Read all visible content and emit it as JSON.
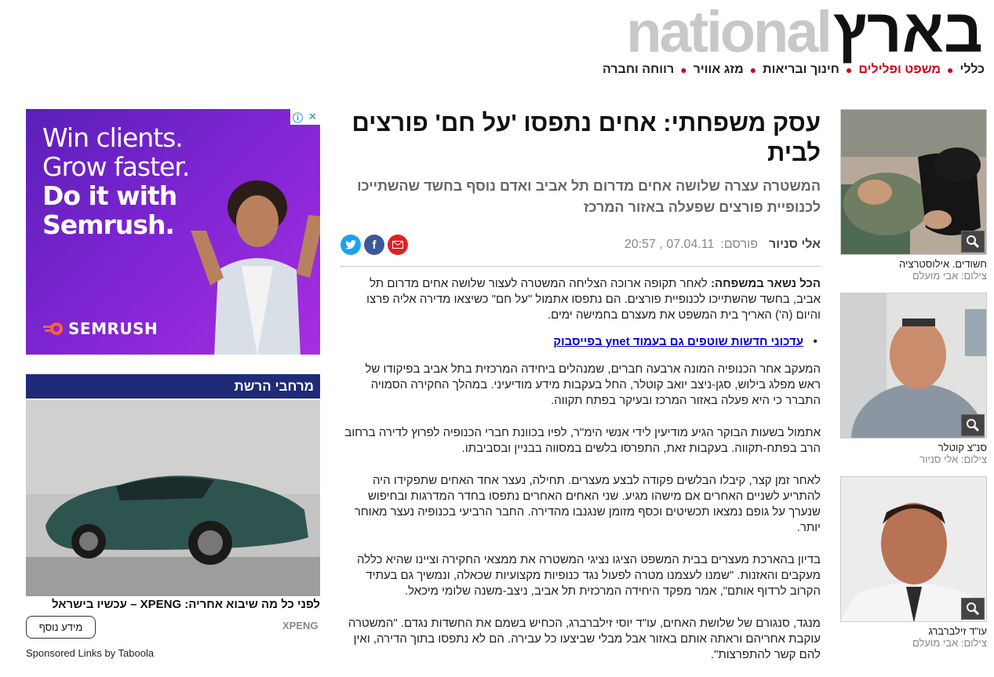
{
  "logo": {
    "national": "national",
    "hebrew": "בארץ"
  },
  "nav": {
    "items": [
      {
        "label": "כללי",
        "active": false
      },
      {
        "label": "משפט ופלילים",
        "active": true
      },
      {
        "label": "חינוך ובריאות",
        "active": false
      },
      {
        "label": "מזג אוויר",
        "active": false
      },
      {
        "label": "רווחה וחברה",
        "active": false
      }
    ]
  },
  "article": {
    "headline": "עסק משפחתי: אחים נתפסו 'על חם' פורצים לבית",
    "subtitle": "המשטרה עצרה שלושה אחים מדרום תל אביב ואדם נוסף בחשד שהשתייכו לכנופיית פורצים שפעלה באזור המרכז",
    "author": "אלי סניור",
    "published_label": "פורסם:",
    "date": "07.04.11",
    "time": "20:57",
    "lead_label": "הכל נשאר במשפחה:",
    "lead_text": " לאחר תקופה ארוכה הצליחה המשטרה לעצור שלושה אחים מדרום תל אביב, בחשד שהשתייכו לכנופיית פורצים. הם נתפסו אתמול \"על חם\" כשיצאו מדירה אליה פרצו והיום (ה') האריך בית המשפט את מעצרם בחמישה ימים.",
    "fb_link": "עדכוני חדשות שוטפים גם בעמוד ynet בפייסבוק",
    "paragraphs": [
      "המעקב אחר הכנופיה המונה ארבעה חברים, שמנהלים ביחידה המרכזית בתל אביב בפיקודו של ראש מפלג בילוש, סגן-ניצב יואב קוטלר, החל בעקבות מידע מודיעיני. במהלך החקירה הסמויה התברר כי היא פעלה באזור המרכז ובעיקר בפתח תקווה.",
      "אתמול בשעות הבוקר הגיע מודיעין לידי אנשי הימ\"ר, לפיו בכוונת חברי הכנופיה לפרוץ לדירה ברחוב הרב בפתח-תקווה. בעקבות זאת, התפרסו בלשים במסווה בבניין ובסביבתו.",
      "לאחר זמן קצר, קיבלו הבלשים פקודה לבצע מעצרים. תחילה, נעצר אחד האחים שתפקידו היה להתריע לשניים האחרים אם מישהו מגיע. שני האחים האחרים נתפסו בחדר המדרגות ובחיפוש שנערך על גופם נמצאו תכשיטים וכסף מזומן שנגנבו מהדירה. החבר הרביעי בכנופיה נעצר מאוחר יותר.",
      "בדיון בהארכת מעצרים בבית המשפט הציגו נציגי המשטרה את ממצאי החקירה וציינו שהיא כללה מעקבים והאזנות. \"שמנו לעצמנו מטרה לפעול נגד כנופיות מקצועיות שכאלה, ונמשיך גם בעתיד הקרוב לרדוף אותם\", אמר מפקד היחידה המרכזית תל אביב, ניצב-משנה שלומי מיכאל.",
      "מנגד, סנגורם של שלושת האחים, עו\"ד יוסי זילברברג, הכחיש בשמם את החשדות נגדם. \"המשטרה עוקבת אחריהם וראתה אותם באזור אבל מבלי שביצעו כל עבירה. הם לא נתפסו בתוך הדירה, ואין להם קשר להתפרצות\"."
    ]
  },
  "share": {
    "twitter": "twitter-icon",
    "facebook": "facebook-icon",
    "email": "email-icon"
  },
  "photos": [
    {
      "caption": "חשודים. אילוסטרציה",
      "credit": "צילום: אבי מועלם"
    },
    {
      "caption": "סנ\"צ קוטלר",
      "credit": "צילום: אלי סניור"
    },
    {
      "caption": "עו\"ד זילברברג",
      "credit": "צילום: אבי מועלם"
    }
  ],
  "ad": {
    "line1": "Win clients.",
    "line2": "Grow faster.",
    "line3": "Do it with",
    "line4": "Semrush.",
    "brand": "SEMRUSH"
  },
  "sidebar": {
    "section_title": "מרחבי הרשת",
    "promo_title": "לפני כל מה שיבוא אחריה: XPENG – עכשיו בישראל",
    "promo_source": "XPENG",
    "more_button": "מידע נוסף",
    "taboola": "Sponsored Links by Taboola"
  },
  "colors": {
    "accent_red": "#d0021b",
    "section_blue": "#1f2a78",
    "link_blue": "#0000cc"
  }
}
